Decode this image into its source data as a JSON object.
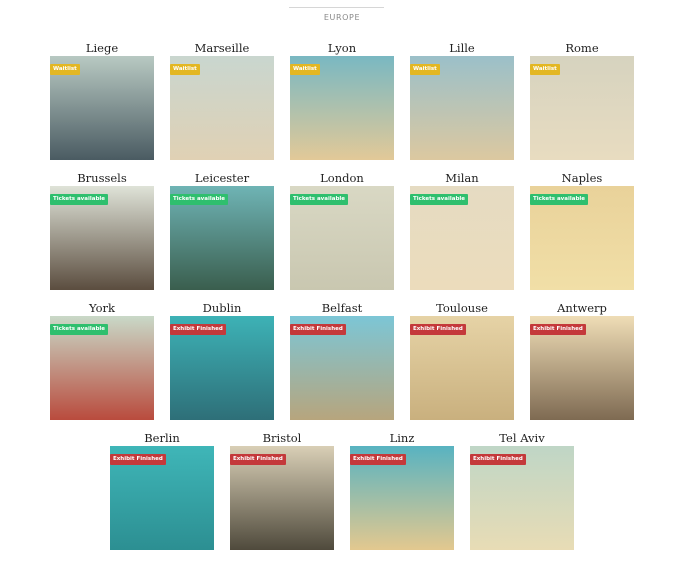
{
  "section": {
    "title": "EUROPE"
  },
  "colors": {
    "waitlist": "#e3b723",
    "available": "#2fbf6e",
    "finished": "#c4393b"
  },
  "rows": [
    [
      {
        "city": "Liege",
        "status": "Waitlist",
        "kind": "waitlist",
        "scene": "river-town",
        "palette": [
          "#b8c9c2",
          "#7a8b6f",
          "#c2a276",
          "#4a5b62"
        ]
      },
      {
        "city": "Marseille",
        "status": "Waitlist",
        "kind": "waitlist",
        "scene": "hill-basilica",
        "palette": [
          "#c9d6cf",
          "#a88a6c",
          "#8c6c52",
          "#e0d1b4"
        ]
      },
      {
        "city": "Lyon",
        "status": "Waitlist",
        "kind": "waitlist",
        "scene": "cathedral-river",
        "palette": [
          "#79b8c2",
          "#c9a267",
          "#3f7d82",
          "#e2c998"
        ]
      },
      {
        "city": "Lille",
        "status": "Waitlist",
        "kind": "waitlist",
        "scene": "square-tower",
        "palette": [
          "#9bc0c9",
          "#b48d5f",
          "#6f7d6c",
          "#dcc8a0"
        ]
      },
      {
        "city": "Rome",
        "status": "Waitlist",
        "kind": "waitlist",
        "scene": "dome-square",
        "palette": [
          "#d6d3bf",
          "#bfa77d",
          "#9c8a6a",
          "#e8dcc0"
        ]
      }
    ],
    [
      {
        "city": "Brussels",
        "status": "Tickets available",
        "kind": "available",
        "scene": "grand-place",
        "palette": [
          "#dfe3d8",
          "#8f7b63",
          "#c8b89a",
          "#5b4d3f"
        ]
      },
      {
        "city": "Leicester",
        "status": "Tickets available",
        "kind": "available",
        "scene": "park-city",
        "palette": [
          "#6fb4b5",
          "#4f8f3a",
          "#98bf58",
          "#3a5e4e"
        ]
      },
      {
        "city": "London",
        "status": "Tickets available",
        "kind": "available",
        "scene": "clock-tower",
        "palette": [
          "#d9d8c4",
          "#8a6c45",
          "#b89a6a",
          "#c9c7b0"
        ]
      },
      {
        "city": "Milan",
        "status": "Tickets available",
        "kind": "available",
        "scene": "duomo",
        "palette": [
          "#e5dbc2",
          "#c9b48e",
          "#a98f6a",
          "#ecdcbc"
        ]
      },
      {
        "city": "Naples",
        "status": "Tickets available",
        "kind": "available",
        "scene": "sun-dome",
        "palette": [
          "#e9d29a",
          "#c79a4a",
          "#8f6a3a",
          "#f1dfa7"
        ]
      }
    ],
    [
      {
        "city": "York",
        "status": "Tickets available",
        "kind": "available",
        "scene": "river-boats",
        "palette": [
          "#c9d9c8",
          "#5f8e7a",
          "#9fb48c",
          "#b94b3d"
        ]
      },
      {
        "city": "Dublin",
        "status": "Exhibit Finished",
        "kind": "finished",
        "scene": "georgian-doors",
        "palette": [
          "#3db2b6",
          "#9c4a32",
          "#e3cf8c",
          "#2e6f78"
        ]
      },
      {
        "city": "Belfast",
        "status": "Exhibit Finished",
        "kind": "finished",
        "scene": "city-hall",
        "palette": [
          "#7cc6d6",
          "#dcc99c",
          "#5e9a4c",
          "#b7a57d"
        ]
      },
      {
        "city": "Toulouse",
        "status": "Exhibit Finished",
        "kind": "finished",
        "scene": "riverside-dome",
        "palette": [
          "#e6d3a6",
          "#3f6b5a",
          "#7a8a6a",
          "#c9b07e"
        ]
      },
      {
        "city": "Antwerp",
        "status": "Exhibit Finished",
        "kind": "finished",
        "scene": "skyline-spire",
        "palette": [
          "#efddb6",
          "#a98e6a",
          "#c9ad82",
          "#7e6a52"
        ]
      }
    ],
    [
      {
        "city": "Berlin",
        "status": "Exhibit Finished",
        "kind": "finished",
        "scene": "tv-tower",
        "palette": [
          "#3fb6b8",
          "#d4c6a6",
          "#e7dcc2",
          "#2c8f92"
        ]
      },
      {
        "city": "Bristol",
        "status": "Exhibit Finished",
        "kind": "finished",
        "scene": "ferris-wheel",
        "palette": [
          "#d9cfb6",
          "#8e7a5a",
          "#bfae88",
          "#4f4a3c"
        ]
      },
      {
        "city": "Linz",
        "status": "Exhibit Finished",
        "kind": "finished",
        "scene": "town-aerial",
        "palette": [
          "#58b3c1",
          "#c69b5e",
          "#7e8f57",
          "#e3c88f"
        ]
      },
      {
        "city": "Tel Aviv",
        "status": "Exhibit Finished",
        "kind": "finished",
        "scene": "beach-city",
        "palette": [
          "#bfd6c6",
          "#d8c79a",
          "#5a9e9a",
          "#e8dcb5"
        ]
      }
    ]
  ]
}
